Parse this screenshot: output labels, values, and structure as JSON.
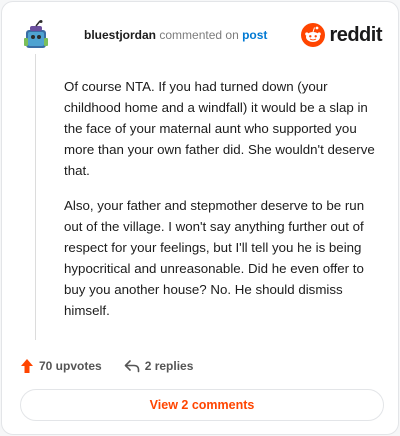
{
  "header": {
    "username": "bluestjordan",
    "verb": "commented on",
    "post_link": "post",
    "logo_text": "reddit",
    "avatar_icon": "snoo-avatar-icon"
  },
  "comment": {
    "paragraphs": [
      "Of course NTA. If you had turned down (your childhood home and a windfall) it would be a slap in the face of your maternal aunt who supported you more than your own father did. She wouldn't deserve that.",
      "Also, your father and stepmother deserve to be run out of the village. I won't say anything further out of respect for your feelings, but I'll tell you he is being hypocritical and unreasonable. Did he even offer to buy you another house? No. He should dismiss himself."
    ]
  },
  "actions": {
    "upvotes": "70 upvotes",
    "replies": "2 replies"
  },
  "view_button": "View 2 comments",
  "colors": {
    "accent": "#ff4500",
    "link": "#0079d3"
  }
}
